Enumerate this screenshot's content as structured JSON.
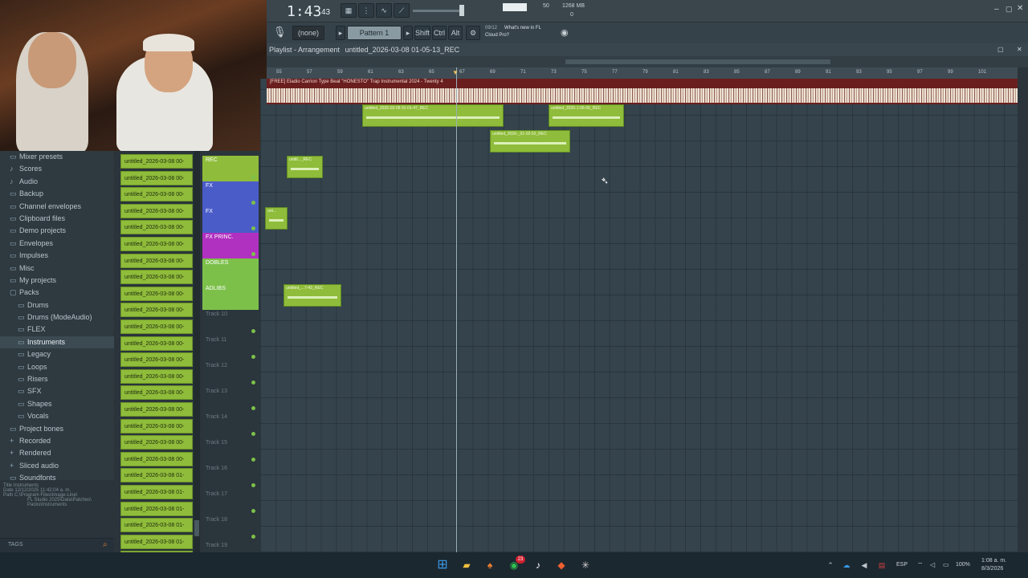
{
  "app": {
    "time": "1:43",
    "time_frames": "43",
    "memory": "1268 MB",
    "cpu": "50",
    "voices": "0",
    "pattern": "Pattern 1",
    "channel": "(none)",
    "hint_counter": "09/12",
    "hint_text_1": "What's new in FL",
    "hint_text_2": "Cloud Pro?",
    "modifiers": [
      "Shift",
      "Ctrl",
      "Alt"
    ]
  },
  "playlist": {
    "title": "Playlist - Arrangement",
    "arrangement": "untitled_2026-03-08 01-05-13_REC",
    "audio_track_label": "[FREE] Eladio Carrion Type Beat \"HONESTO\" Trap Instrumental 2024 - Twenty 4"
  },
  "ruler": [
    "55",
    "57",
    "59",
    "61",
    "63",
    "65",
    "67",
    "69",
    "71",
    "73",
    "75",
    "77",
    "79",
    "81",
    "83",
    "85",
    "87",
    "89",
    "91",
    "93",
    "95",
    "97",
    "99",
    "101"
  ],
  "browser": {
    "items": [
      {
        "label": "Mixer presets",
        "icon": "folder",
        "level": 0,
        "selected": false
      },
      {
        "label": "Scores",
        "icon": "note",
        "level": 0,
        "selected": false
      },
      {
        "label": "Audio",
        "icon": "note",
        "level": 0,
        "selected": false
      },
      {
        "label": "Backup",
        "icon": "folder",
        "level": 0,
        "selected": false
      },
      {
        "label": "Channel envelopes",
        "icon": "folder",
        "level": 0,
        "selected": false
      },
      {
        "label": "Clipboard files",
        "icon": "folder",
        "level": 0,
        "selected": false
      },
      {
        "label": "Demo projects",
        "icon": "folder",
        "level": 0,
        "selected": false
      },
      {
        "label": "Envelopes",
        "icon": "folder",
        "level": 0,
        "selected": false
      },
      {
        "label": "Impulses",
        "icon": "folder",
        "level": 0,
        "selected": false
      },
      {
        "label": "Misc",
        "icon": "folder",
        "level": 0,
        "selected": false
      },
      {
        "label": "My projects",
        "icon": "folder",
        "level": 0,
        "selected": false
      },
      {
        "label": "Packs",
        "icon": "folder-open",
        "level": 0,
        "selected": false
      },
      {
        "label": "Drums",
        "icon": "folder",
        "level": 1,
        "selected": false
      },
      {
        "label": "Drums (ModeAudio)",
        "icon": "folder",
        "level": 1,
        "selected": false
      },
      {
        "label": "FLEX",
        "icon": "folder",
        "level": 1,
        "selected": false
      },
      {
        "label": "Instruments",
        "icon": "folder",
        "level": 1,
        "selected": true
      },
      {
        "label": "Legacy",
        "icon": "folder",
        "level": 1,
        "selected": false
      },
      {
        "label": "Loops",
        "icon": "folder",
        "level": 1,
        "selected": false
      },
      {
        "label": "Risers",
        "icon": "folder",
        "level": 1,
        "selected": false
      },
      {
        "label": "SFX",
        "icon": "folder",
        "level": 1,
        "selected": false
      },
      {
        "label": "Shapes",
        "icon": "folder",
        "level": 1,
        "selected": false
      },
      {
        "label": "Vocals",
        "icon": "folder",
        "level": 1,
        "selected": false
      },
      {
        "label": "Project bones",
        "icon": "folder",
        "level": 0,
        "selected": false
      },
      {
        "label": "Recorded",
        "icon": "plus",
        "level": 0,
        "selected": false
      },
      {
        "label": "Rendered",
        "icon": "plus",
        "level": 0,
        "selected": false
      },
      {
        "label": "Sliced audio",
        "icon": "plus",
        "level": 0,
        "selected": false
      },
      {
        "label": "Soundfonts",
        "icon": "folder",
        "level": 0,
        "selected": false
      }
    ],
    "info": {
      "title_label": "Title",
      "title_value": "Instruments",
      "date_label": "Date",
      "date_value": "12/12/2025 11:42:04 a. m.",
      "path_label": "Path",
      "path_value_1": "C:\\Program Files\\Image-Line\\",
      "path_value_2": "FL Studio 2025\\Data\\Patches\\",
      "path_value_3": "Packs\\Instruments"
    },
    "tags_label": "TAGS"
  },
  "channels": [
    "untitled_2026-03-08 00-",
    "untitled_2026-03-08 00-",
    "untitled_2026-03-08 00-",
    "untitled_2026-03-08 00-",
    "untitled_2026-03-08 00-",
    "untitled_2026-03-08 00-",
    "untitled_2026-03-08 00-",
    "untitled_2026-03-08 00-",
    "untitled_2026-03-08 00-",
    "untitled_2026-03-08 00-",
    "untitled_2026-03-08 00-",
    "untitled_2026-03-08 00-",
    "untitled_2026-03-08 00-",
    "untitled_2026-03-08 00-",
    "untitled_2026-03-08 00-",
    "untitled_2026-03-08 00-",
    "untitled_2026-03-08 00-",
    "untitled_2026-03-08 00-",
    "untitled_2026-03-08 00-",
    "untitled_2026-03-08 01-",
    "untitled_2026-03-08 01-",
    "untitled_2026-03-08 01-",
    "untitled_2026-03-08 01-",
    "untitled_2026-03-08 01-",
    "untitled_2026-03-08 01-"
  ],
  "tracks": [
    {
      "name": "REC",
      "color": "#8fbc3a"
    },
    {
      "name": "FX",
      "color": "#4a5cc8"
    },
    {
      "name": "FX",
      "color": "#4a5cc8"
    },
    {
      "name": "FX PRINC.",
      "color": "#b030c0"
    },
    {
      "name": "DOBLES",
      "color": "#7cc04a"
    },
    {
      "name": "ADLIBS",
      "color": "#7cc04a"
    },
    {
      "name": "Track 10",
      "color": ""
    },
    {
      "name": "Track 11",
      "color": ""
    },
    {
      "name": "Track 12",
      "color": ""
    },
    {
      "name": "Track 13",
      "color": ""
    },
    {
      "name": "Track 14",
      "color": ""
    },
    {
      "name": "Track 15",
      "color": ""
    },
    {
      "name": "Track 16",
      "color": ""
    },
    {
      "name": "Track 17",
      "color": ""
    },
    {
      "name": "Track 18",
      "color": ""
    },
    {
      "name": "Track 19",
      "color": ""
    }
  ],
  "clips": [
    {
      "label": "untitled_2026-03-08 01-01-47_REC"
    },
    {
      "label": "untitled_2026-1-06-06_REC"
    },
    {
      "label": "untitled_2026-_01-02-52_REC"
    },
    {
      "label": "untitl..._REC"
    },
    {
      "label": "unt..."
    },
    {
      "label": "untitled_...7-43_REC"
    }
  ],
  "taskbar": {
    "lang": "ESP",
    "volume": "100%",
    "time": "1:08 a. m.",
    "date": "8/3/2026",
    "whatsapp_badge": "23"
  }
}
